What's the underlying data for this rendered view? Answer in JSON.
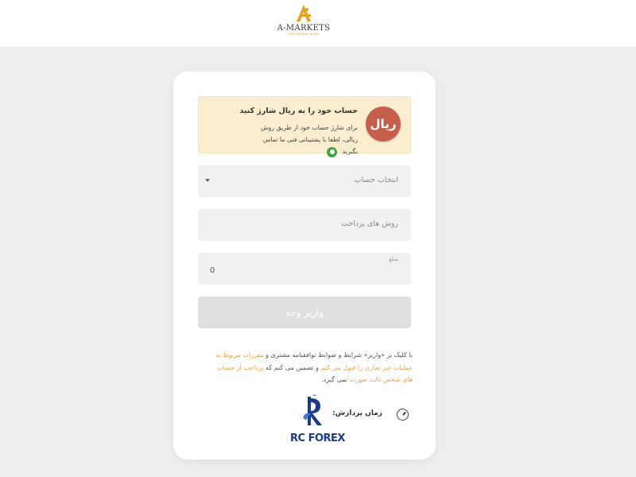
{
  "header": {
    "logo_text": "A-MARKETS",
    "logo_tagline": "YOUR TRADING BUDDY"
  },
  "notice": {
    "badge_text": "ریال",
    "title": "حساب خود را به ریال شارژ کنید",
    "text": "برای شارژ حساب خود از طریق روش ریالی، لطفا با پشتیبانی فنی ما تماس بگیرید"
  },
  "form": {
    "account_select_label": "انتخاب حساب",
    "payment_methods_label": "روش های پرداخت",
    "amount_label": "مبلغ",
    "amount_value": "0",
    "submit_label": "واریز وجه"
  },
  "terms": {
    "part1": "با کلیک بر «واریز» شرایط و ضوابط توافقنامه مشتری و",
    "link1": "مقررات مربوط به عملیات غیر تجاری را قبول می کنم",
    "part2": "و تضمین می کنم که",
    "link2": "پرداخت از حساب های شخص ثالث صورت",
    "part3": "نمی گیرد."
  },
  "processing": {
    "label": "زمان پردازش:"
  },
  "provider": {
    "name": "RC FOREX"
  },
  "colors": {
    "accent": "#eda24a",
    "notice_bg": "#fbedcf",
    "rial_badge": "#c55f4c",
    "provider_blue": "#1a3a8a"
  }
}
